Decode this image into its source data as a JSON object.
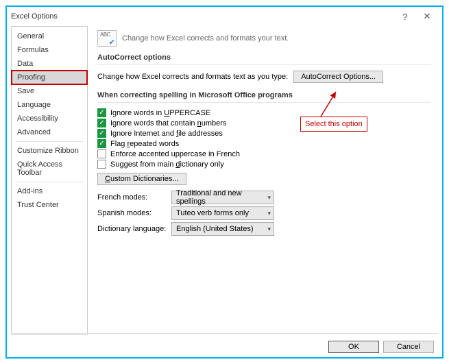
{
  "window": {
    "title": "Excel Options"
  },
  "sidebar": {
    "items": [
      {
        "label": "General"
      },
      {
        "label": "Formulas"
      },
      {
        "label": "Data"
      },
      {
        "label": "Proofing",
        "selected": true
      },
      {
        "label": "Save"
      },
      {
        "label": "Language"
      },
      {
        "label": "Accessibility"
      },
      {
        "label": "Advanced"
      },
      {
        "label": "Customize Ribbon"
      },
      {
        "label": "Quick Access Toolbar"
      },
      {
        "label": "Add-ins"
      },
      {
        "label": "Trust Center"
      }
    ]
  },
  "hero": {
    "text": "Change how Excel corrects and formats your text."
  },
  "sections": {
    "autocorrect": {
      "heading": "AutoCorrect options",
      "prompt": "Change how Excel corrects and formats text as you type:",
      "button": "AutoCorrect Options..."
    },
    "spelling": {
      "heading": "When correcting spelling in Microsoft Office programs",
      "checks": [
        {
          "label": "Ignore words in UPPERCASE",
          "accel": "U",
          "checked": true
        },
        {
          "label": "Ignore words that contain numbers",
          "accel": "n",
          "checked": true
        },
        {
          "label": "Ignore Internet and file addresses",
          "accel": "f",
          "checked": true
        },
        {
          "label": "Flag repeated words",
          "accel": "r",
          "checked": true
        },
        {
          "label": "Enforce accented uppercase in French",
          "accel": "",
          "checked": false
        },
        {
          "label": "Suggest from main dictionary only",
          "accel": "d",
          "checked": false
        }
      ],
      "custom_dict_btn": "Custom Dictionaries...",
      "french_label": "French modes:",
      "french_value": "Traditional and new spellings",
      "spanish_label": "Spanish modes:",
      "spanish_value": "Tuteo verb forms only",
      "dictlang_label": "Dictionary language:",
      "dictlang_value": "English (United States)"
    }
  },
  "annotation": {
    "text": "Select this option"
  },
  "footer": {
    "ok": "OK",
    "cancel": "Cancel"
  }
}
